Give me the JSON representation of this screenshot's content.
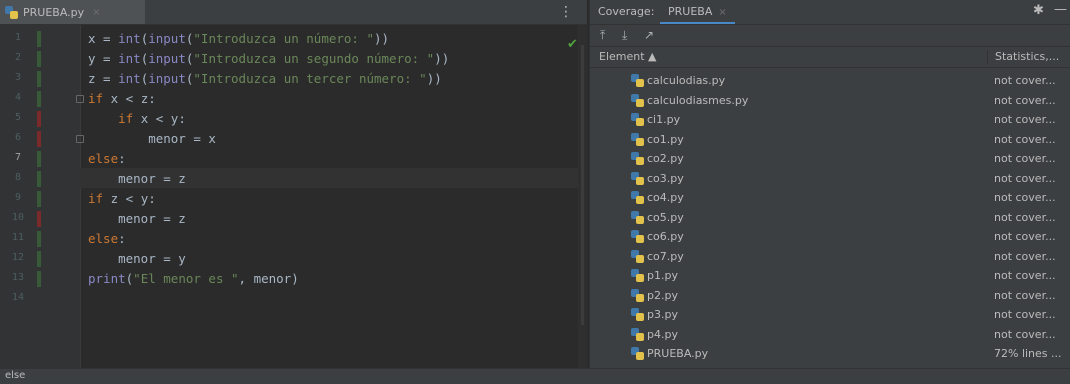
{
  "editor": {
    "tab_label": "PRUEBA.py",
    "tab_close": "×",
    "menu_icon": "kebab-icon",
    "inspection_status": "ok-check-icon",
    "current_line": 7,
    "lines": [
      {
        "n": "1",
        "cov": "green"
      },
      {
        "n": "2",
        "cov": "green"
      },
      {
        "n": "3",
        "cov": "green"
      },
      {
        "n": "4",
        "cov": "green"
      },
      {
        "n": "5",
        "cov": "red"
      },
      {
        "n": "6",
        "cov": "red"
      },
      {
        "n": "7",
        "cov": "green"
      },
      {
        "n": "8",
        "cov": "green"
      },
      {
        "n": "9",
        "cov": "green"
      },
      {
        "n": "10",
        "cov": "red"
      },
      {
        "n": "11",
        "cov": "green"
      },
      {
        "n": "12",
        "cov": "green"
      },
      {
        "n": "13",
        "cov": "green"
      },
      {
        "n": "14",
        "cov": ""
      }
    ],
    "code": [
      [
        {
          "t": "x = ",
          "c": ""
        },
        {
          "t": "int",
          "c": "fn"
        },
        {
          "t": "(",
          "c": ""
        },
        {
          "t": "input",
          "c": "fn"
        },
        {
          "t": "(",
          "c": ""
        },
        {
          "t": "\"Introduzca un número: \"",
          "c": "str"
        },
        {
          "t": "))",
          "c": ""
        }
      ],
      [
        {
          "t": "y = ",
          "c": ""
        },
        {
          "t": "int",
          "c": "fn"
        },
        {
          "t": "(",
          "c": ""
        },
        {
          "t": "input",
          "c": "fn"
        },
        {
          "t": "(",
          "c": ""
        },
        {
          "t": "\"Introduzca un segundo número: \"",
          "c": "str"
        },
        {
          "t": "))",
          "c": ""
        }
      ],
      [
        {
          "t": "z = ",
          "c": ""
        },
        {
          "t": "int",
          "c": "fn"
        },
        {
          "t": "(",
          "c": ""
        },
        {
          "t": "input",
          "c": "fn"
        },
        {
          "t": "(",
          "c": ""
        },
        {
          "t": "\"Introduzca un tercer número: \"",
          "c": "str"
        },
        {
          "t": "))",
          "c": ""
        }
      ],
      [
        {
          "t": "if",
          "c": "kw"
        },
        {
          "t": " x < z:",
          "c": ""
        }
      ],
      [
        {
          "t": "    ",
          "c": ""
        },
        {
          "t": "if",
          "c": "kw"
        },
        {
          "t": " x < y:",
          "c": ""
        }
      ],
      [
        {
          "t": "        menor = x",
          "c": ""
        }
      ],
      [
        {
          "t": "else",
          "c": "kw"
        },
        {
          "t": ":",
          "c": ""
        }
      ],
      [
        {
          "t": "    menor = z",
          "c": ""
        }
      ],
      [
        {
          "t": "if",
          "c": "kw"
        },
        {
          "t": " z < y:",
          "c": ""
        }
      ],
      [
        {
          "t": "    menor = z",
          "c": ""
        }
      ],
      [
        {
          "t": "else",
          "c": "kw"
        },
        {
          "t": ":",
          "c": ""
        }
      ],
      [
        {
          "t": "    menor = y",
          "c": ""
        }
      ],
      [
        {
          "t": "print",
          "c": "fn"
        },
        {
          "t": "(",
          "c": ""
        },
        {
          "t": "\"El menor es \"",
          "c": "str"
        },
        {
          "t": ", menor)",
          "c": ""
        }
      ],
      []
    ]
  },
  "status_bar": {
    "text": "else"
  },
  "coverage": {
    "title": "Coverage:",
    "tab_label": "PRUEBA",
    "tab_close": "×",
    "toolbar_icons": [
      "flatten-up-icon",
      "flatten-down-icon",
      "export-icon"
    ],
    "columns": {
      "element": "Element ▲",
      "statistics": "Statistics,..."
    },
    "rows": [
      {
        "name": "calculodias.py",
        "stat": "not cover..."
      },
      {
        "name": "calculodiasmes.py",
        "stat": "not cover..."
      },
      {
        "name": "ci1.py",
        "stat": "not cover..."
      },
      {
        "name": "co1.py",
        "stat": "not cover..."
      },
      {
        "name": "co2.py",
        "stat": "not cover..."
      },
      {
        "name": "co3.py",
        "stat": "not cover..."
      },
      {
        "name": "co4.py",
        "stat": "not cover..."
      },
      {
        "name": "co5.py",
        "stat": "not cover..."
      },
      {
        "name": "co6.py",
        "stat": "not cover..."
      },
      {
        "name": "co7.py",
        "stat": "not cover..."
      },
      {
        "name": "p1.py",
        "stat": "not cover..."
      },
      {
        "name": "p2.py",
        "stat": "not cover..."
      },
      {
        "name": "p3.py",
        "stat": "not cover..."
      },
      {
        "name": "p4.py",
        "stat": "not cover..."
      },
      {
        "name": "PRUEBA.py",
        "stat": "72% lines ..."
      }
    ]
  }
}
